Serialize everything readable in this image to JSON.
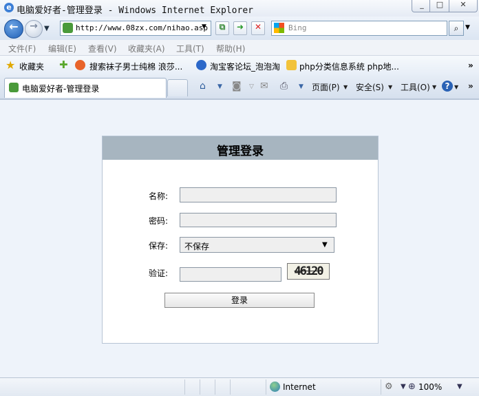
{
  "window": {
    "title": "电脑爱好者-管理登录 - Windows Internet Explorer"
  },
  "address_bar": {
    "url": "http://www.08zx.com/nihao.asp",
    "search_placeholder": "Bing"
  },
  "menu": [
    "文件(F)",
    "编辑(E)",
    "查看(V)",
    "收藏夹(A)",
    "工具(T)",
    "帮助(H)"
  ],
  "favorites_bar": {
    "favorites_label": "收藏夹",
    "links": [
      "搜索袜子男士纯棉 浪莎...",
      "淘宝客论坛_泡泡淘",
      "php分类信息系统 php地..."
    ]
  },
  "tab": {
    "label": "电脑爱好者-管理登录"
  },
  "command_bar": {
    "page": "页面(P)",
    "safety": "安全(S)",
    "tools": "工具(O)"
  },
  "login": {
    "title": "管理登录",
    "name_label": "名称:",
    "password_label": "密码:",
    "save_label": "保存:",
    "save_selected": "不保存",
    "verify_label": "验证:",
    "captcha_text": "46120",
    "submit_label": "登录"
  },
  "status_bar": {
    "zone": "Internet",
    "zoom": "100%"
  }
}
